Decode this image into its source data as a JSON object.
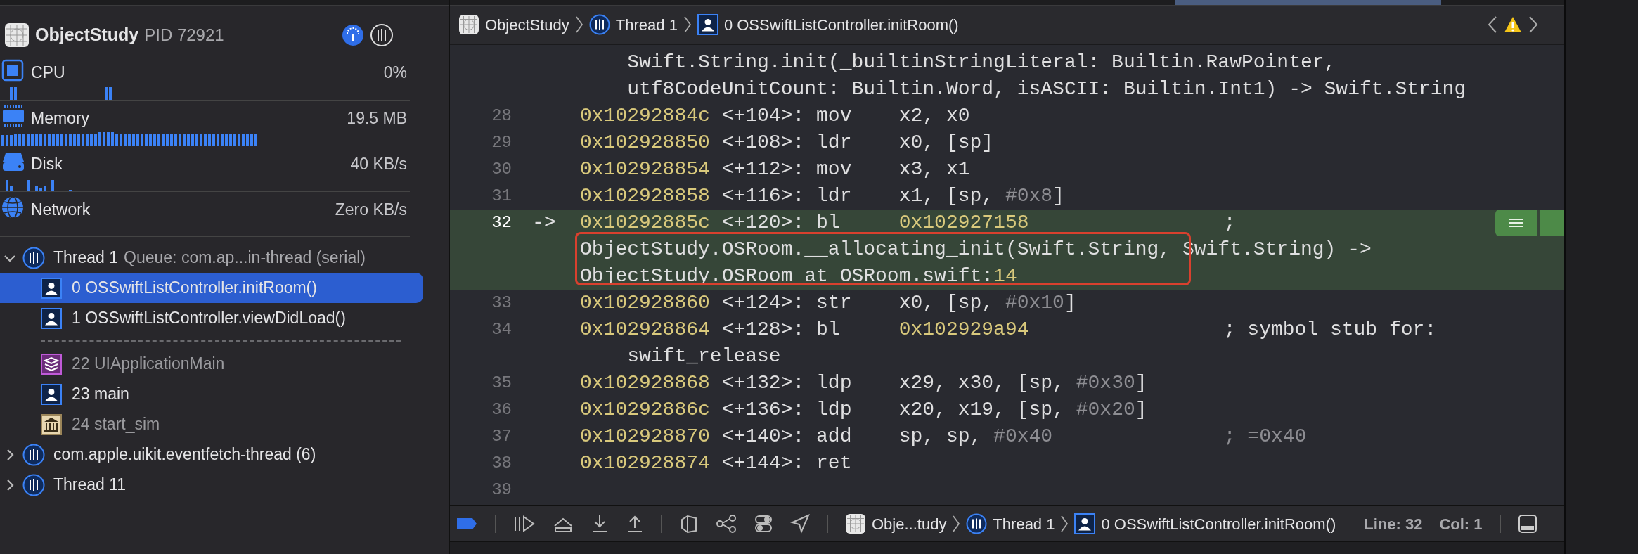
{
  "sidebar": {
    "process": {
      "name": "ObjectStudy",
      "pid": "PID 72921"
    },
    "gauges": [
      {
        "kind": "cpu",
        "label": "CPU",
        "value": "0%"
      },
      {
        "kind": "memory",
        "label": "Memory",
        "value": "19.5 MB"
      },
      {
        "kind": "disk",
        "label": "Disk",
        "value": "40 KB/s"
      },
      {
        "kind": "network",
        "label": "Network",
        "value": "Zero KB/s"
      }
    ],
    "threads": [
      {
        "label": "Thread 1",
        "detail": "Queue: com.ap...in-thread (serial)",
        "expanded": true,
        "children": [
          {
            "kind": "user",
            "label": "0 OSSwiftListController.initRoom()",
            "selected": true,
            "dimmed": false
          },
          {
            "kind": "user",
            "label": "1 OSSwiftListController.viewDidLoad()",
            "selected": false,
            "dimmed": false
          },
          {
            "kind": "separator"
          },
          {
            "kind": "framework",
            "label": "22 UIApplicationMain",
            "selected": false,
            "dimmed": true
          },
          {
            "kind": "user",
            "label": "23 main",
            "selected": false,
            "dimmed": false
          },
          {
            "kind": "system",
            "label": "24 start_sim",
            "selected": false,
            "dimmed": true
          }
        ]
      },
      {
        "label": "com.apple.uikit.eventfetch-thread (6)",
        "expanded": false
      },
      {
        "label": "Thread 11",
        "expanded": false
      }
    ]
  },
  "editor": {
    "jump_bar": [
      {
        "kind": "app",
        "label": "ObjectStudy"
      },
      {
        "kind": "thread",
        "label": "Thread 1"
      },
      {
        "kind": "user",
        "label": "0 OSSwiftListController.initRoom()"
      }
    ],
    "annotation_box": true,
    "code_rows": [
      {
        "kind": "hanging",
        "current": false,
        "tokens": [
          {
            "text": "Swift.String.init(_builtinStringLiteral: Builtin.RawPointer,",
            "kind": "plain"
          }
        ]
      },
      {
        "kind": "hanging",
        "current": false,
        "tokens": [
          {
            "text": "utf8CodeUnitCount: Builtin.Word, isASCII: Builtin.Int1) -> Swift.String",
            "kind": "plain"
          }
        ]
      },
      {
        "kind": "instruction",
        "number": "28",
        "current": false,
        "address": "0x10292884c",
        "offset": "<+104>:",
        "mnemonic": "mov",
        "operands": [
          {
            "text": "x2, x0",
            "kind": "plain"
          }
        ]
      },
      {
        "kind": "instruction",
        "number": "29",
        "current": false,
        "address": "0x102928850",
        "offset": "<+108>:",
        "mnemonic": "ldr",
        "operands": [
          {
            "text": "x0, [sp]",
            "kind": "plain"
          }
        ]
      },
      {
        "kind": "instruction",
        "number": "30",
        "current": false,
        "address": "0x102928854",
        "offset": "<+112>:",
        "mnemonic": "mov",
        "operands": [
          {
            "text": "x3, x1",
            "kind": "plain"
          }
        ]
      },
      {
        "kind": "instruction",
        "number": "31",
        "current": false,
        "address": "0x102928858",
        "offset": "<+116>:",
        "mnemonic": "ldr",
        "operands": [
          {
            "text": "x1, [sp, ",
            "kind": "plain"
          },
          {
            "text": "#0x8",
            "kind": "number"
          },
          {
            "text": "]",
            "kind": "plain"
          }
        ]
      },
      {
        "kind": "instruction",
        "number": "32",
        "current": true,
        "marker": "->",
        "address": "0x10292885c",
        "offset": "<+120>:",
        "mnemonic": "bl",
        "operands": [
          {
            "text": "0x102927158",
            "kind": "address"
          }
        ],
        "comment": [
          {
            "text": ";",
            "kind": "plain"
          }
        ]
      },
      {
        "kind": "aligned",
        "current": true,
        "tokens": [
          {
            "text": "ObjectStudy.OSRoom.__allocating_init(Swift.String, Swift.String) ->",
            "kind": "plain"
          }
        ]
      },
      {
        "kind": "aligned",
        "current": true,
        "tokens": [
          {
            "text": "ObjectStudy.OSRoom at OSRoom.swift:",
            "kind": "plain"
          },
          {
            "text": "14",
            "kind": "address"
          }
        ]
      },
      {
        "kind": "instruction",
        "number": "33",
        "current": false,
        "address": "0x102928860",
        "offset": "<+124>:",
        "mnemonic": "str",
        "operands": [
          {
            "text": "x0, [sp, ",
            "kind": "plain"
          },
          {
            "text": "#0x10",
            "kind": "number"
          },
          {
            "text": "]",
            "kind": "plain"
          }
        ]
      },
      {
        "kind": "instruction",
        "number": "34",
        "current": false,
        "address": "0x102928864",
        "offset": "<+128>:",
        "mnemonic": "bl",
        "operands": [
          {
            "text": "0x102929a94",
            "kind": "address"
          }
        ],
        "comment": [
          {
            "text": "; symbol stub for:",
            "kind": "plain"
          }
        ]
      },
      {
        "kind": "hanging",
        "current": false,
        "tokens": [
          {
            "text": "swift_release",
            "kind": "plain"
          }
        ]
      },
      {
        "kind": "instruction",
        "number": "35",
        "current": false,
        "address": "0x102928868",
        "offset": "<+132>:",
        "mnemonic": "ldp",
        "operands": [
          {
            "text": "x29, x30, [sp, ",
            "kind": "plain"
          },
          {
            "text": "#0x30",
            "kind": "number"
          },
          {
            "text": "]",
            "kind": "plain"
          }
        ]
      },
      {
        "kind": "instruction",
        "number": "36",
        "current": false,
        "address": "0x10292886c",
        "offset": "<+136>:",
        "mnemonic": "ldp",
        "operands": [
          {
            "text": "x20, x19, [sp, ",
            "kind": "plain"
          },
          {
            "text": "#0x20",
            "kind": "number"
          },
          {
            "text": "]",
            "kind": "plain"
          }
        ]
      },
      {
        "kind": "instruction",
        "number": "37",
        "current": false,
        "address": "0x102928870",
        "offset": "<+140>:",
        "mnemonic": "add",
        "operands": [
          {
            "text": "sp, sp, ",
            "kind": "plain"
          },
          {
            "text": "#0x40",
            "kind": "number"
          }
        ],
        "comment": [
          {
            "text": "; =0x40",
            "kind": "number"
          }
        ]
      },
      {
        "kind": "instruction",
        "number": "38",
        "current": false,
        "address": "0x102928874",
        "offset": "<+144>:",
        "mnemonic": "ret",
        "operands": []
      },
      {
        "kind": "empty",
        "number": "39",
        "current": false
      }
    ]
  },
  "debug_bar": {
    "breakpoints_active": true,
    "jump_bar": [
      {
        "kind": "app",
        "label": "Obje...tudy"
      },
      {
        "kind": "thread",
        "label": "Thread 1"
      },
      {
        "kind": "user",
        "label": "0 OSSwiftListController.initRoom()"
      }
    ],
    "line": "Line: 32",
    "col": "Col: 1"
  }
}
